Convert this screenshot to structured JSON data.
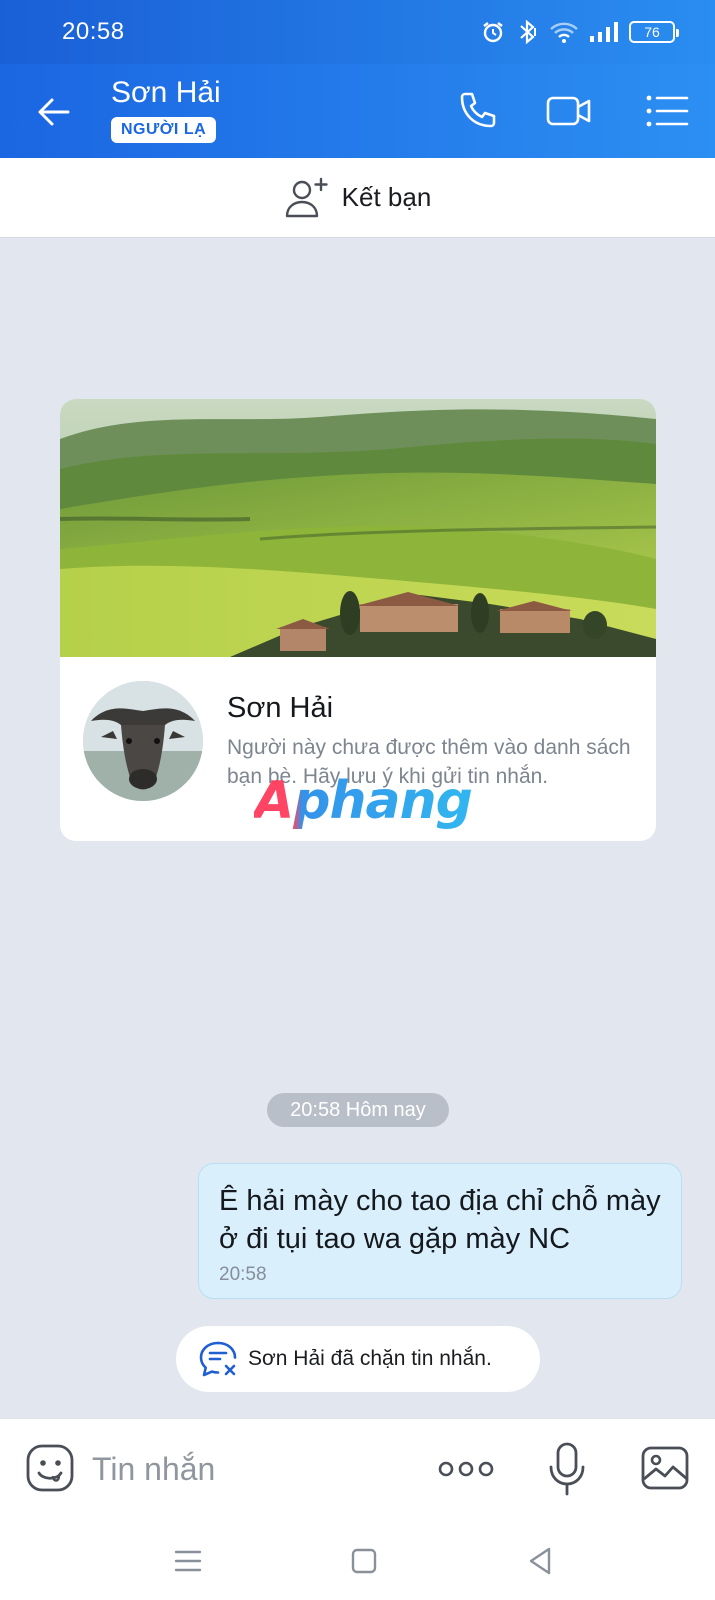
{
  "status_bar": {
    "time": "20:58",
    "battery": "76",
    "icons": [
      "alarm-icon",
      "bluetooth-icon",
      "wifi-icon",
      "signal-icon",
      "battery-icon"
    ]
  },
  "header": {
    "contact_name": "Sơn Hải",
    "badge": "NGƯỜI LẠ",
    "icons": [
      "back-arrow-icon",
      "phone-icon",
      "video-call-icon",
      "menu-list-icon"
    ],
    "accent_color": "#1b66e2"
  },
  "add_friend": {
    "label": "Kết bạn",
    "icon": "add-user-icon"
  },
  "profile_card": {
    "name": "Sơn Hải",
    "note": "Người này chưa được thêm vào danh sách bạn bè. Hãy lưu ý khi gửi tin nhắn.",
    "watermark": "Aphang"
  },
  "conversation": {
    "time_chip": "20:58 Hôm nay",
    "messages": [
      {
        "direction": "outgoing",
        "text": "Ê hải mày cho tao địa chỉ chỗ mày ở đi tụi tao wa gặp mày NC",
        "time": "20:58"
      }
    ],
    "blocked_notice": {
      "name": "Sơn Hải",
      "text": " đã chặn tin nhắn."
    }
  },
  "composer": {
    "placeholder": "Tin nhắn",
    "icons": [
      "emoji-icon",
      "more-icon",
      "microphone-icon",
      "image-icon"
    ]
  },
  "nav_bar": {
    "icons": [
      "recent-apps-icon",
      "home-icon",
      "back-icon"
    ]
  }
}
